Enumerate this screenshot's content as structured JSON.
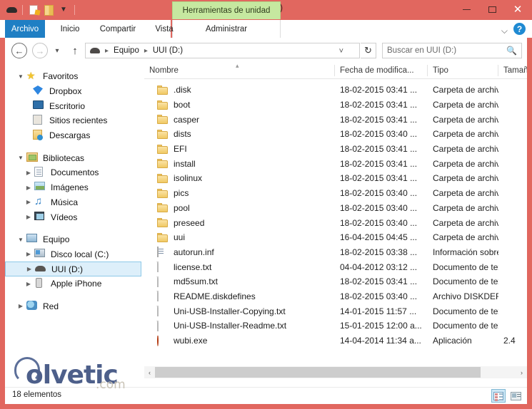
{
  "window": {
    "title": "UUI (D:)",
    "contextual_tab": "Herramientas de unidad",
    "minimize_label": "Minimizar",
    "maximize_label": "Maximizar",
    "close_label": "Cerrar",
    "accent_color": "#e1675f",
    "contextual_tab_color": "#c6e8a0",
    "file_tab_color": "#1f7fc4"
  },
  "quick_access": [
    {
      "name": "drive-icon",
      "label": "Unidad"
    },
    {
      "name": "properties-icon",
      "label": "Propiedades"
    },
    {
      "name": "new-folder-icon",
      "label": "Nueva carpeta"
    },
    {
      "name": "chevron-down-icon",
      "label": "Personalizar barra de herramientas"
    }
  ],
  "ribbon": {
    "tabs": [
      {
        "id": "file",
        "label": "Archivo"
      },
      {
        "id": "home",
        "label": "Inicio"
      },
      {
        "id": "share",
        "label": "Compartir"
      },
      {
        "id": "view",
        "label": "Vista"
      },
      {
        "id": "manage",
        "label": "Administrar"
      }
    ],
    "collapse_icon": "chevron-down-icon",
    "help_icon": "help-icon",
    "help_glyph": "?"
  },
  "navbar": {
    "back_glyph": "←",
    "forward_glyph": "→",
    "recent_glyph": "▾",
    "up_glyph": "↑",
    "breadcrumb": [
      "Equipo",
      "UUI (D:)"
    ],
    "breadcrumb_separator": "▸",
    "address_chevron": "˅",
    "refresh_glyph": "↻",
    "search_placeholder": "Buscar en UUI (D:)",
    "search_value": "",
    "search_icon": "search-icon"
  },
  "sidebar": {
    "groups": [
      {
        "id": "favoritos",
        "header": {
          "label": "Favoritos",
          "icon": "star-icon",
          "twisty": "open"
        },
        "items": [
          {
            "label": "Dropbox",
            "icon": "dropbox-icon",
            "twisty": "none"
          },
          {
            "label": "Escritorio",
            "icon": "desktop-icon",
            "twisty": "none"
          },
          {
            "label": "Sitios recientes",
            "icon": "recent-places-icon",
            "twisty": "none"
          },
          {
            "label": "Descargas",
            "icon": "downloads-icon",
            "twisty": "none"
          }
        ]
      },
      {
        "id": "bibliotecas",
        "header": {
          "label": "Bibliotecas",
          "icon": "libraries-icon",
          "twisty": "open"
        },
        "items": [
          {
            "label": "Documentos",
            "icon": "documents-icon",
            "twisty": "closed"
          },
          {
            "label": "Imágenes",
            "icon": "pictures-icon",
            "twisty": "closed"
          },
          {
            "label": "Música",
            "icon": "music-icon",
            "twisty": "closed"
          },
          {
            "label": "Vídeos",
            "icon": "videos-icon",
            "twisty": "closed"
          }
        ]
      },
      {
        "id": "equipo",
        "header": {
          "label": "Equipo",
          "icon": "computer-icon",
          "twisty": "open"
        },
        "items": [
          {
            "label": "Disco local (C:)",
            "icon": "harddisk-icon",
            "twisty": "closed",
            "selected": false
          },
          {
            "label": "UUI (D:)",
            "icon": "removable-drive-icon",
            "twisty": "closed",
            "selected": true
          },
          {
            "label": "Apple iPhone",
            "icon": "phone-icon",
            "twisty": "closed",
            "selected": false
          }
        ]
      },
      {
        "id": "red",
        "header": {
          "label": "Red",
          "icon": "network-icon",
          "twisty": "closed"
        },
        "items": []
      }
    ]
  },
  "filelist": {
    "columns": [
      {
        "id": "name",
        "label": "Nombre",
        "sorted": true,
        "sort_glyph": "▴"
      },
      {
        "id": "date",
        "label": "Fecha de modifica..."
      },
      {
        "id": "type",
        "label": "Tipo"
      },
      {
        "id": "size",
        "label": "Tamañ"
      }
    ],
    "rows": [
      {
        "name": ".disk",
        "icon": "folder-icon",
        "date": "18-02-2015 03:41 ...",
        "type": "Carpeta de archivos",
        "size": ""
      },
      {
        "name": "boot",
        "icon": "folder-icon",
        "date": "18-02-2015 03:41 ...",
        "type": "Carpeta de archivos",
        "size": ""
      },
      {
        "name": "casper",
        "icon": "folder-icon",
        "date": "18-02-2015 03:41 ...",
        "type": "Carpeta de archivos",
        "size": ""
      },
      {
        "name": "dists",
        "icon": "folder-icon",
        "date": "18-02-2015 03:40 ...",
        "type": "Carpeta de archivos",
        "size": ""
      },
      {
        "name": "EFI",
        "icon": "folder-icon",
        "date": "18-02-2015 03:41 ...",
        "type": "Carpeta de archivos",
        "size": ""
      },
      {
        "name": "install",
        "icon": "folder-icon",
        "date": "18-02-2015 03:41 ...",
        "type": "Carpeta de archivos",
        "size": ""
      },
      {
        "name": "isolinux",
        "icon": "folder-icon",
        "date": "18-02-2015 03:41 ...",
        "type": "Carpeta de archivos",
        "size": ""
      },
      {
        "name": "pics",
        "icon": "folder-icon",
        "date": "18-02-2015 03:40 ...",
        "type": "Carpeta de archivos",
        "size": ""
      },
      {
        "name": "pool",
        "icon": "folder-icon",
        "date": "18-02-2015 03:40 ...",
        "type": "Carpeta de archivos",
        "size": ""
      },
      {
        "name": "preseed",
        "icon": "folder-icon",
        "date": "18-02-2015 03:40 ...",
        "type": "Carpeta de archivos",
        "size": ""
      },
      {
        "name": "uui",
        "icon": "folder-icon",
        "date": "16-04-2015 04:45 ...",
        "type": "Carpeta de archivos",
        "size": ""
      },
      {
        "name": "autorun.inf",
        "icon": "inf-file-icon",
        "date": "18-02-2015 03:38 ...",
        "type": "Información sobre...",
        "size": ""
      },
      {
        "name": "license.txt",
        "icon": "text-file-icon",
        "date": "04-04-2012 03:12 ...",
        "type": "Documento de tex...",
        "size": ""
      },
      {
        "name": "md5sum.txt",
        "icon": "text-file-icon",
        "date": "18-02-2015 03:41 ...",
        "type": "Documento de tex...",
        "size": ""
      },
      {
        "name": "README.diskdefines",
        "icon": "generic-file-icon",
        "date": "18-02-2015 03:40 ...",
        "type": "Archivo DISKDEFI...",
        "size": ""
      },
      {
        "name": "Uni-USB-Installer-Copying.txt",
        "icon": "text-file-icon",
        "date": "14-01-2015 11:57 ...",
        "type": "Documento de tex...",
        "size": ""
      },
      {
        "name": "Uni-USB-Installer-Readme.txt",
        "icon": "text-file-icon",
        "date": "15-01-2015 12:00 a...",
        "type": "Documento de tex...",
        "size": ""
      },
      {
        "name": "wubi.exe",
        "icon": "ubuntu-app-icon",
        "date": "14-04-2014 11:34 a...",
        "type": "Aplicación",
        "size": "2.4"
      }
    ]
  },
  "scrollbar": {
    "left_glyph": "‹",
    "right_glyph": "›"
  },
  "statusbar": {
    "item_count": "18 elementos",
    "views": [
      {
        "id": "details",
        "label": "Detalles",
        "icon": "details-view-icon",
        "active": true
      },
      {
        "id": "large",
        "label": "Iconos grandes",
        "icon": "large-icons-view-icon",
        "active": false
      }
    ]
  },
  "watermark": {
    "brand": "olvetic",
    "suffix": ".com"
  }
}
